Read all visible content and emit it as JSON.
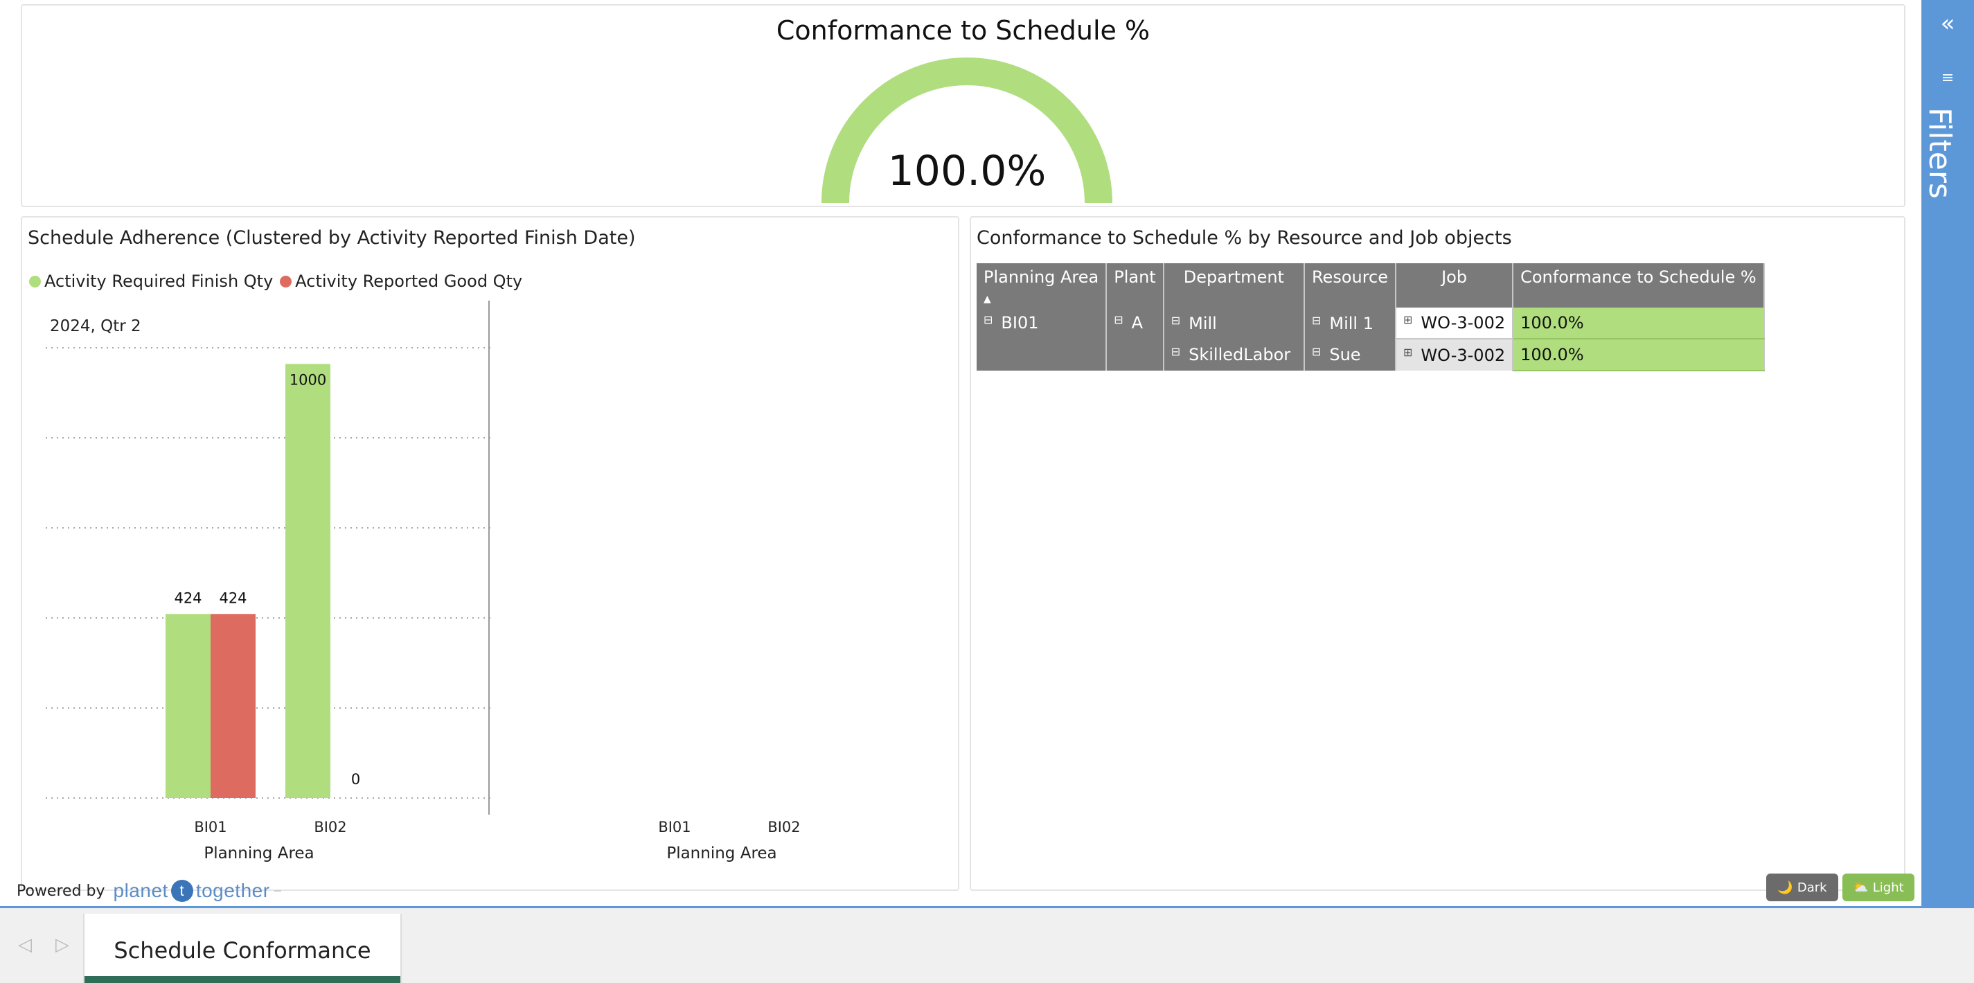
{
  "gauge": {
    "title": "Conformance to Schedule %",
    "value_label": "100.0%",
    "value_fraction": 1.0,
    "color": "#b0de7e"
  },
  "bar_chart": {
    "title": "Schedule Adherence (Clustered by Activity Reported Finish Date)",
    "legend": [
      "Activity Required Finish Qty",
      "Activity Reported Good Qty"
    ],
    "colors": [
      "#b0de7e",
      "#de6b5f"
    ]
  },
  "chart_data": {
    "type": "bar",
    "title": "Schedule Adherence (Clustered by Activity Reported Finish Date)",
    "facets": [
      {
        "label": "2024, Qtr 2",
        "categories": [
          "BI01",
          "BI02"
        ],
        "series": [
          {
            "name": "Activity Required Finish Qty",
            "values": [
              424,
              1000
            ]
          },
          {
            "name": "Activity Reported Good Qty",
            "values": [
              424,
              0
            ]
          }
        ],
        "xlabel": "Planning Area"
      },
      {
        "label": "",
        "categories": [
          "BI01",
          "BI02"
        ],
        "series": [],
        "xlabel": "Planning Area"
      }
    ],
    "ylim": [
      0,
      1050
    ],
    "grid": true,
    "legend_position": "top-left"
  },
  "matrix": {
    "title": "Conformance to Schedule % by Resource and Job objects",
    "headers": [
      "Planning Area",
      "Plant",
      "Department",
      "Resource",
      "Job",
      "Conformance to Schedule %"
    ],
    "sort_indicator": "▲",
    "planning_area": "BI01",
    "plant": "A",
    "rows": [
      {
        "department": "Mill",
        "resource": "Mill 1",
        "job": "WO-3-002",
        "pct": "100.0%"
      },
      {
        "department": "SkilledLabor",
        "resource": "Sue",
        "job": "WO-3-002",
        "pct": "100.0%"
      }
    ],
    "collapse_glyph": "⊟",
    "expand_glyph": "⊞"
  },
  "footer": {
    "powered_by": "Powered by",
    "logo_left": "planet",
    "logo_mark": "t",
    "logo_right": "together"
  },
  "theme": {
    "dark_label": "Dark",
    "light_label": "Light",
    "dark_icon": "🌙",
    "light_icon": "⛅"
  },
  "filters": {
    "label": "Filters",
    "collapse_icon": "«",
    "filter_icon": "≡"
  },
  "tabs": {
    "prev_icon": "◁",
    "next_icon": "▷",
    "active": "Schedule Conformance"
  }
}
